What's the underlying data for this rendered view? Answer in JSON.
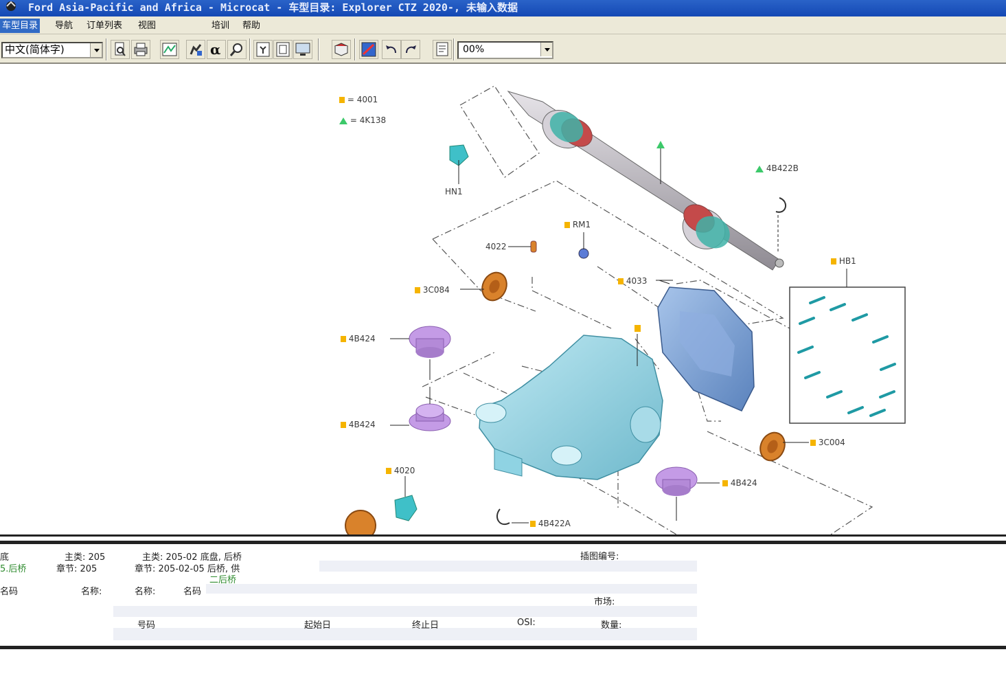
{
  "window": {
    "title": "Ford Asia-Pacific and Africa - Microcat - 车型目录: Explorer CTZ 2020-, 未输入数据",
    "icon": "microcat-app-icon"
  },
  "menu": {
    "items": [
      "车型目录",
      "导航",
      "订单列表",
      "视图",
      "培训",
      "帮助"
    ],
    "active": "车型目录"
  },
  "toolbar": {
    "language": "中文(简体字)",
    "zoom": "00%",
    "buttons": [
      "print-preview",
      "print",
      "map",
      "find-part",
      "alpha-search",
      "zoom",
      "frame-select",
      "frame",
      "monitor",
      "book",
      "illustration",
      "undo",
      "redo",
      "notes"
    ]
  },
  "diagram": {
    "legend": [
      {
        "symbol": "square",
        "text": "= 4001"
      },
      {
        "symbol": "triangle",
        "text": "= 4K138"
      }
    ],
    "callouts": {
      "hn1": "HN1",
      "c4b422b": "4B422B",
      "rm1": "RM1",
      "c4022": "4022",
      "hb1": "HB1",
      "c3c084": "3C084",
      "c4033": "4033",
      "c4b424a": "4B424",
      "c4b424b": "4B424",
      "c3c004": "3C004",
      "c4020": "4020",
      "c4b424c": "4B424",
      "c4b422a": "4B422A"
    },
    "colors": {
      "marker_square": "#f5b400",
      "marker_triangle": "#3cc96a",
      "housing": "#8fd3e3",
      "cover": "#7fa6d6",
      "bushing": "#c49be6",
      "seal": "#d9822b",
      "bolt": "#3fc0c8",
      "shaft": "#c9c5cc",
      "boot": "#3fb3a8"
    }
  },
  "info": {
    "row1_a": "底",
    "row1_b": "主类: 205",
    "row1_c": "主类: 205-02 底盘, 后桥",
    "row1_d": "插图编号:",
    "row2_a": "5.后桥",
    "row2_b": "章节: 205",
    "row2_c": "章节: 205-02-05 后桥, 供",
    "row2_d": "二后桥",
    "row3_a": "名码",
    "row3_b": "名称:",
    "row3_c": "名称:",
    "row3_d": "名码",
    "row4_a": "市场:",
    "row5_a": "号码",
    "row5_b": "起始日",
    "row5_c": "终止日",
    "row5_d": "OSI:",
    "row5_e": "数量:"
  }
}
